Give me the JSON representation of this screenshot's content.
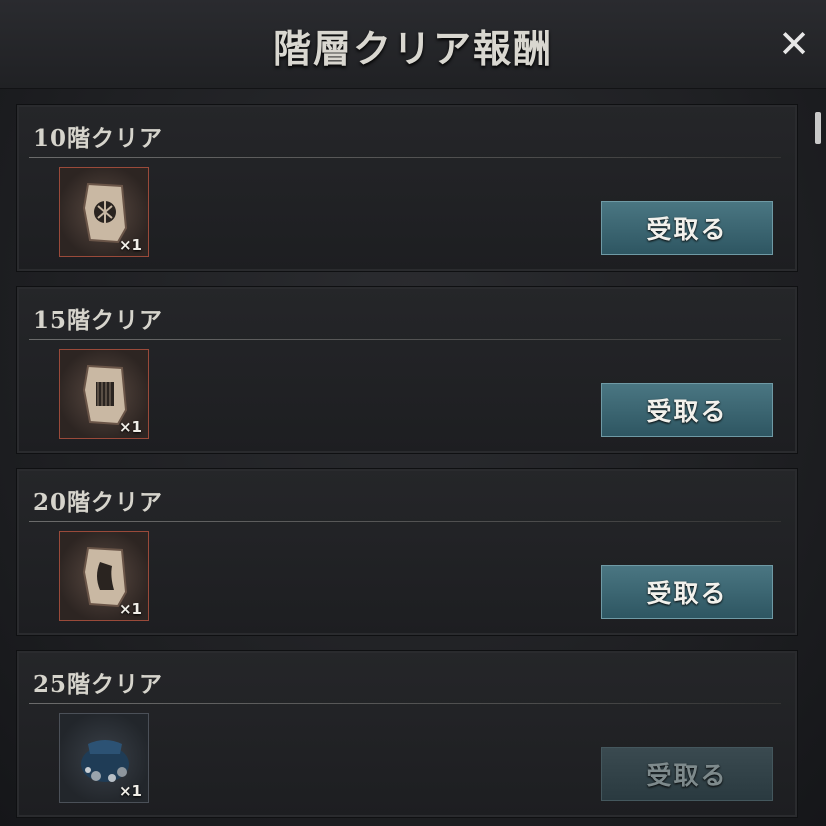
{
  "header": {
    "title": "階層クリア報酬"
  },
  "rewards": [
    {
      "title": "10階クリア",
      "item": {
        "icon": "scroll-icon",
        "qty": "×1"
      },
      "button": "受取る",
      "enabled": true
    },
    {
      "title": "15階クリア",
      "item": {
        "icon": "scroll-icon",
        "qty": "×1"
      },
      "button": "受取る",
      "enabled": true
    },
    {
      "title": "20階クリア",
      "item": {
        "icon": "scroll-icon",
        "qty": "×1"
      },
      "button": "受取る",
      "enabled": true
    },
    {
      "title": "25階クリア",
      "item": {
        "icon": "treasure-bag-icon",
        "qty": "×1"
      },
      "button": "受取る",
      "enabled": false
    }
  ],
  "colors": {
    "button": "#3e6a76",
    "button_disabled": "#2f4046",
    "item_border": "#9a4a3a"
  }
}
